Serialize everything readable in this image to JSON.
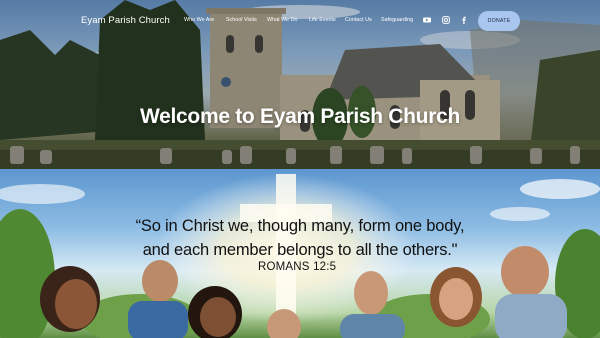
{
  "header": {
    "brand": "Eyam Parish Church",
    "nav": [
      {
        "label": "Who We Are"
      },
      {
        "label": "School Visits"
      },
      {
        "label": "What We Do"
      },
      {
        "label": "Life Events"
      },
      {
        "label": "Contact Us"
      },
      {
        "label": "Safeguarding"
      }
    ],
    "social": [
      "youtube-icon",
      "instagram-icon",
      "facebook-icon"
    ],
    "donate_label": "DONATE"
  },
  "hero": {
    "title": "Welcome to Eyam Parish Church"
  },
  "banner": {
    "verse_line1": "“So in Christ we, though many, form one body,",
    "verse_line2": "and each member belongs to all the others.\"",
    "reference": "ROMANS 12:5"
  },
  "colors": {
    "donate_bg": "#a9c6ef",
    "donate_text": "#1d2c44",
    "nav_text": "#ffffff"
  }
}
